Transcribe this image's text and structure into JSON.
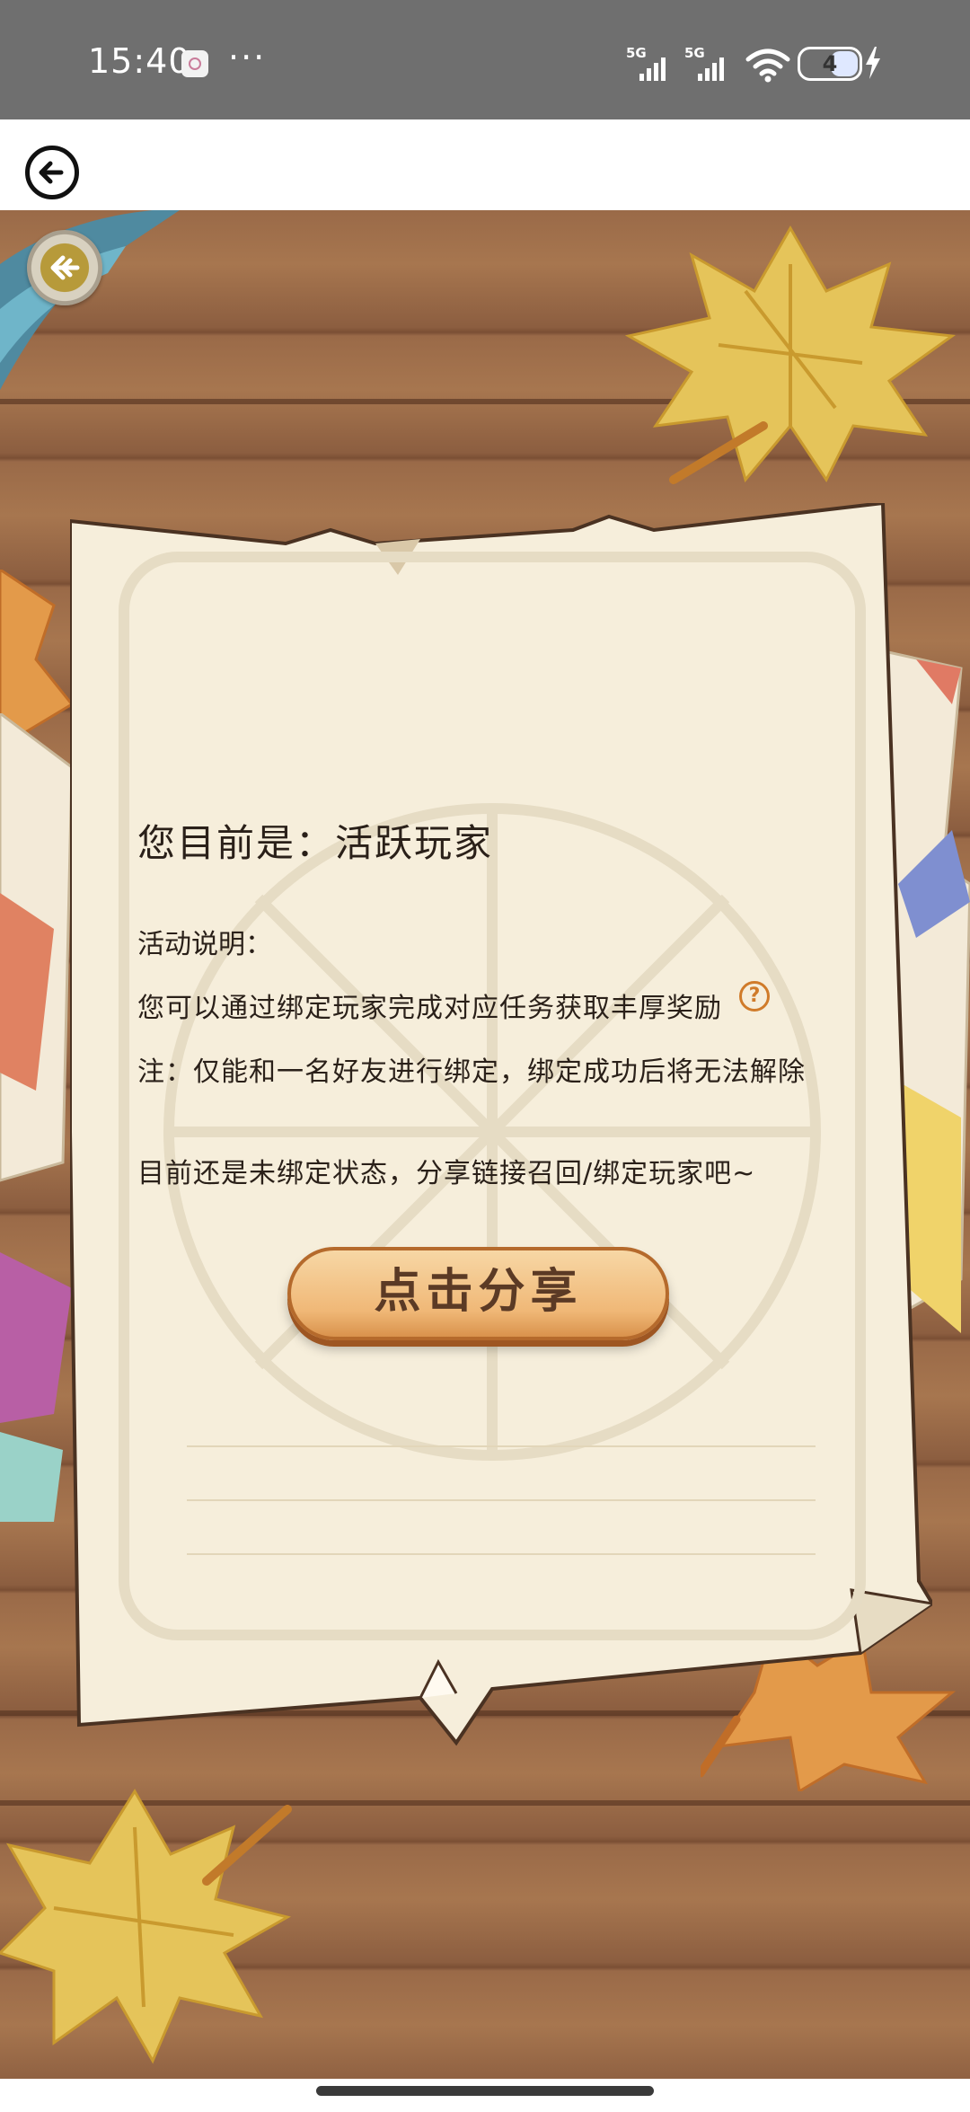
{
  "status_bar": {
    "time": "15:40",
    "more": "···",
    "signal_1": "5G",
    "signal_2": "5G",
    "battery": "4",
    "icons": [
      "app-notification-icon",
      "wifi-icon",
      "battery-icon",
      "charging-icon"
    ]
  },
  "header": {
    "back_icon": "back-arrow-icon"
  },
  "game": {
    "corner_button_icon": "share-arrow-icon",
    "status_line": "您目前是：活跃玩家",
    "description_label": "活动说明：",
    "description_1": "您可以通过绑定玩家完成对应任务获取丰厚奖励",
    "help_icon": "?",
    "description_2": "注：仅能和一名好友进行绑定，绑定成功后将无法解除",
    "description_3": "目前还是未绑定状态，分享链接召回/绑定玩家吧~",
    "share_button_label": "点击分享"
  },
  "colors": {
    "status_bar_bg": "#6f6f6f",
    "paper": "#f6eedb",
    "button_fill": "#f0b877",
    "button_text": "#5b3a25",
    "leaf_yellow": "#e5c45a",
    "wood": "#9a6a48"
  }
}
